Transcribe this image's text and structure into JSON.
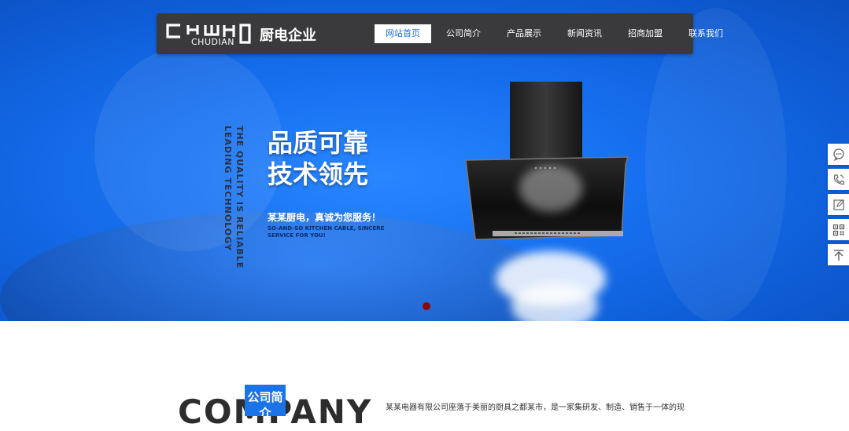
{
  "brand": {
    "logo_text": "CHUDIAN",
    "company_name": "厨电企业"
  },
  "nav": {
    "items": [
      {
        "label": "网站首页",
        "active": true
      },
      {
        "label": "公司简介",
        "active": false
      },
      {
        "label": "产品展示",
        "active": false
      },
      {
        "label": "新闻资讯",
        "active": false
      },
      {
        "label": "招商加盟",
        "active": false
      },
      {
        "label": "联系我们",
        "active": false
      }
    ]
  },
  "hero": {
    "vertical_en_line1": "THE QUALITY IS RELIABLE",
    "vertical_en_line2": "LEADING TECHNOLOGY",
    "slogan_line1": "品质可靠",
    "slogan_line2": "技术领先",
    "subtitle": "某某厨电，真诚为您服务！",
    "subtitle_en": "SO-AND-SO KITCHEN CABLE, SINCERE SERVICE FOR YOU!",
    "active_slide": 1,
    "slide_count": 1
  },
  "side_tools": [
    {
      "icon": "customer-service-icon"
    },
    {
      "icon": "phone-icon"
    },
    {
      "icon": "edit-icon"
    },
    {
      "icon": "qr-code-icon"
    },
    {
      "icon": "back-to-top-icon"
    }
  ],
  "company": {
    "big_title": "COMPANY",
    "badge": "公司简介",
    "description": "某某电器有限公司座落于美丽的厨具之都某市，是一家集研发、制造、销售于一体的现代"
  },
  "colors": {
    "accent": "#1a73e8",
    "nav_bg": "#3a3a3c",
    "hero_bg": "#1872f2",
    "dot": "#8a0a0a"
  }
}
